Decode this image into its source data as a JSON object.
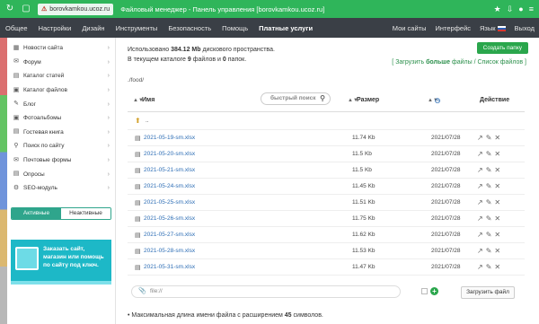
{
  "browser": {
    "url": "borovkamkou.ucoz.ru",
    "tab_title": "Файловый менеджер - Панель управления [borovkamkou.ucoz.ru]"
  },
  "topnav": {
    "items": [
      "Общее",
      "Настройки",
      "Дизайн",
      "Инструменты",
      "Безопасность",
      "Помощь",
      "Платные услуги"
    ],
    "right": [
      "Мои сайты",
      "Интерфейс",
      "Язык",
      "Выход"
    ]
  },
  "sidebar": {
    "items": [
      {
        "label": "Новости сайта",
        "icon": "news-icon"
      },
      {
        "label": "Форум",
        "icon": "forum-icon"
      },
      {
        "label": "Каталог статей",
        "icon": "articles-icon"
      },
      {
        "label": "Каталог файлов",
        "icon": "files-icon"
      },
      {
        "label": "Блог",
        "icon": "blog-icon"
      },
      {
        "label": "Фотоальбомы",
        "icon": "photo-icon"
      },
      {
        "label": "Гостевая книга",
        "icon": "guestbook-icon"
      },
      {
        "label": "Поиск по сайту",
        "icon": "search-icon"
      },
      {
        "label": "Почтовые формы",
        "icon": "mail-icon"
      },
      {
        "label": "Опросы",
        "icon": "poll-icon"
      },
      {
        "label": "SEO-модуль",
        "icon": "seo-icon"
      }
    ],
    "toggle_active": "Активные",
    "toggle_inactive": "Неактивные",
    "promo_text": "Заказать сайт, магазин или помощь по сайту под ключ."
  },
  "main": {
    "disk_prefix": "Использовано",
    "disk_used": "384.12 Mb",
    "disk_suffix": "дискового пространства.",
    "dir_prefix": "В текущем каталоге",
    "dir_files": "9",
    "dir_mid": "файлов и",
    "dir_folders": "0",
    "dir_suffix": "папок.",
    "create_button": "Создать папку",
    "links_open": "[",
    "link_upload_pre": "Загрузить",
    "link_upload_bold": "больше",
    "link_upload_post": "файлы",
    "links_sep": "/",
    "link_list": "Список файлов",
    "links_close": "]",
    "path": "./food/",
    "col_name": "Имя",
    "col_size": "Размер",
    "col_action": "Действие",
    "search_placeholder": "быстрый поиск",
    "up_label": "..",
    "files": [
      {
        "name": "2021-05-19-sm.xlsx",
        "size": "11.74 Kb",
        "date": "2021/07/28"
      },
      {
        "name": "2021-05-20-sm.xlsx",
        "size": "11.5 Kb",
        "date": "2021/07/28"
      },
      {
        "name": "2021-05-21-sm.xlsx",
        "size": "11.5 Kb",
        "date": "2021/07/28"
      },
      {
        "name": "2021-05-24-sm.xlsx",
        "size": "11.45 Kb",
        "date": "2021/07/28"
      },
      {
        "name": "2021-05-25-sm.xlsx",
        "size": "11.51 Kb",
        "date": "2021/07/28"
      },
      {
        "name": "2021-05-26-sm.xlsx",
        "size": "11.75 Kb",
        "date": "2021/07/28"
      },
      {
        "name": "2021-05-27-sm.xlsx",
        "size": "11.62 Kb",
        "date": "2021/07/28"
      },
      {
        "name": "2021-05-28-sm.xlsx",
        "size": "11.53 Kb",
        "date": "2021/07/28"
      },
      {
        "name": "2021-05-31-sm.xlsx",
        "size": "11.47 Kb",
        "date": "2021/07/28"
      }
    ],
    "upload_placeholder": "file://",
    "upload_button": "Загрузить файл",
    "note_prefix": "Максимальная длина имени файла с расширением",
    "note_value": "45",
    "note_suffix": "символов."
  }
}
